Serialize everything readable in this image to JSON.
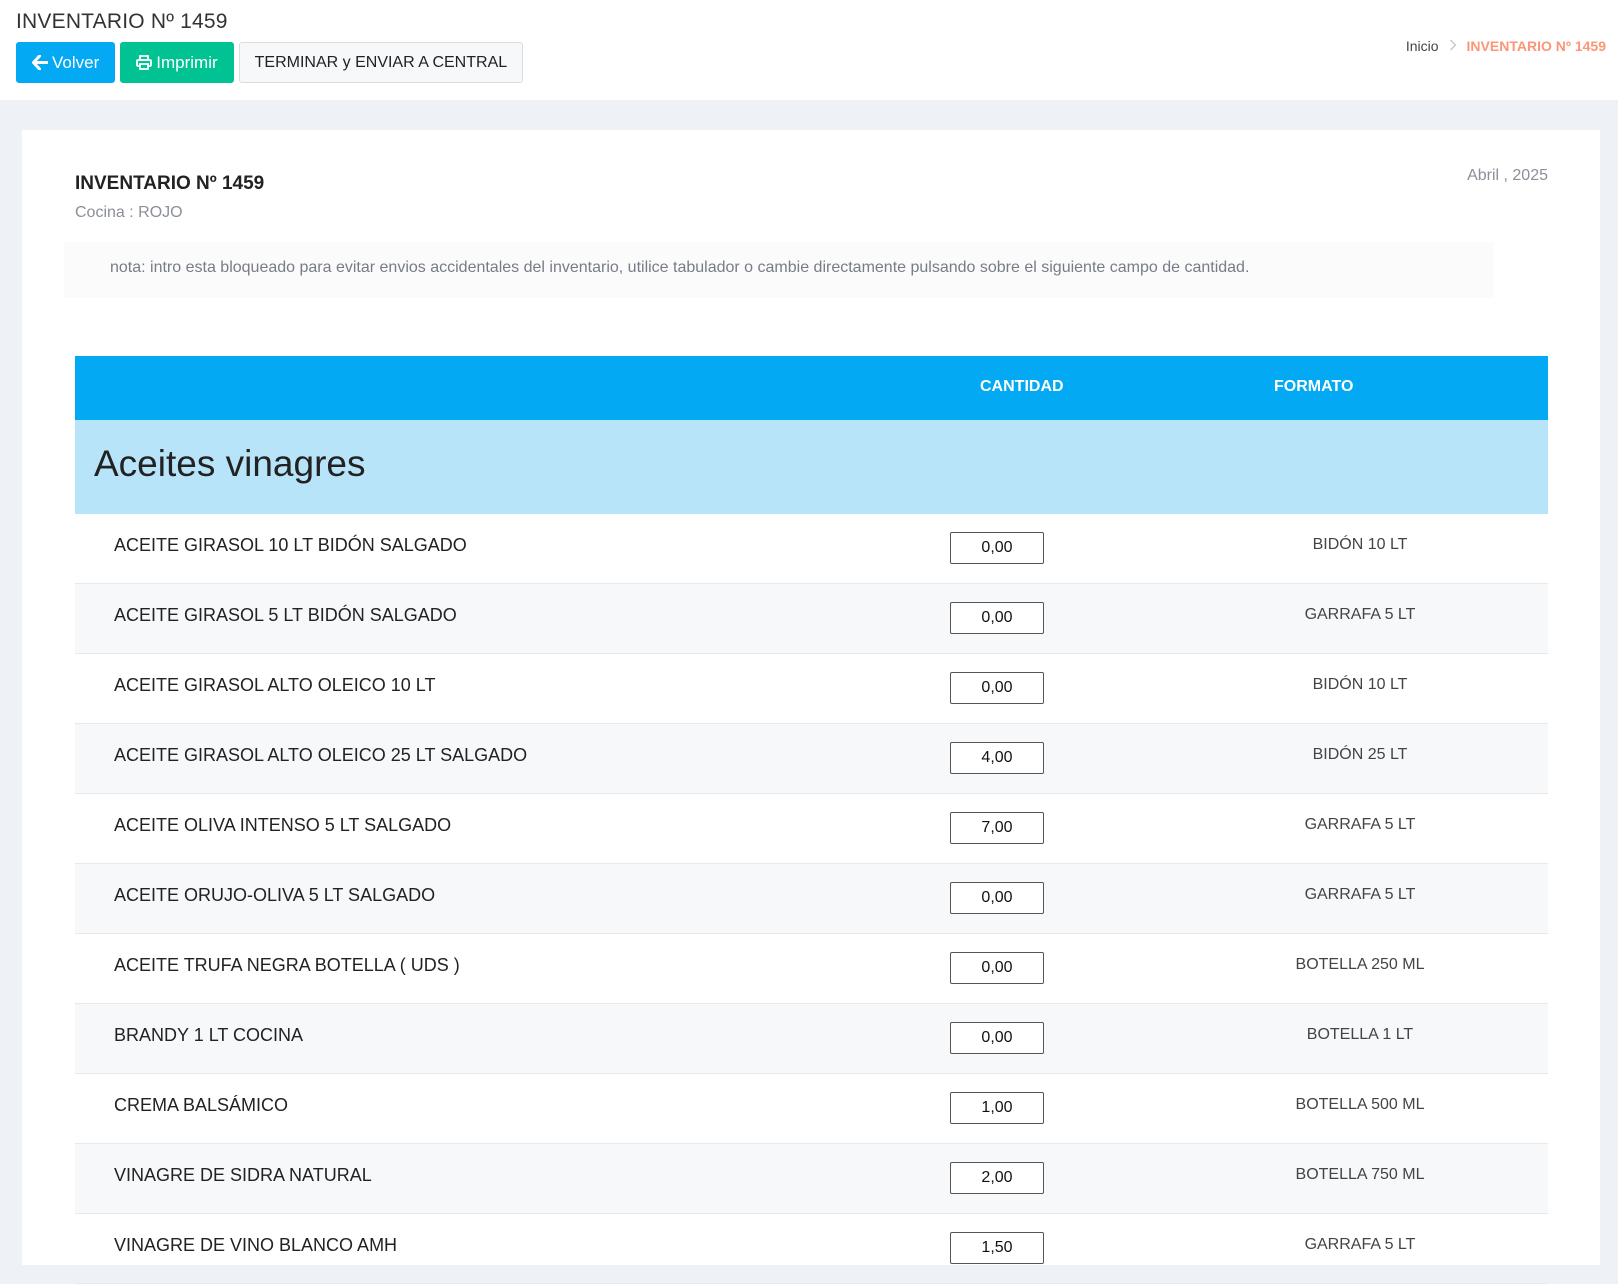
{
  "header": {
    "title": "INVENTARIO Nº 1459",
    "buttons": {
      "back": "Volver",
      "print": "Imprimir",
      "finish": "TERMINAR y ENVIAR A CENTRAL"
    },
    "breadcrumb": {
      "home": "Inicio",
      "current": "INVENTARIO Nº 1459"
    }
  },
  "card": {
    "title": "INVENTARIO Nº 1459",
    "subtitle": "Cocina : ROJO",
    "date": "Abril , 2025",
    "note": "nota: intro esta bloqueado para evitar envios accidentales del inventario, utilice tabulador o cambie directamente pulsando sobre el siguiente campo de cantidad."
  },
  "table": {
    "columns": {
      "quantity": "CANTIDAD",
      "format": "FORMATO"
    },
    "group": "Aceites vinagres",
    "rows": [
      {
        "name": "ACEITE GIRASOL 10 LT BIDÓN SALGADO",
        "quantity": "0,00",
        "format": "BIDÓN 10 LT"
      },
      {
        "name": "ACEITE GIRASOL 5 LT BIDÓN SALGADO",
        "quantity": "0,00",
        "format": "GARRAFA 5 LT"
      },
      {
        "name": "ACEITE GIRASOL ALTO OLEICO 10 LT",
        "quantity": "0,00",
        "format": "BIDÓN 10 LT"
      },
      {
        "name": "ACEITE GIRASOL ALTO OLEICO 25 LT SALGADO",
        "quantity": "4,00",
        "format": "BIDÓN 25 LT"
      },
      {
        "name": "ACEITE OLIVA INTENSO 5 LT SALGADO",
        "quantity": "7,00",
        "format": "GARRAFA 5 LT"
      },
      {
        "name": "ACEITE ORUJO-OLIVA 5 LT SALGADO",
        "quantity": "0,00",
        "format": "GARRAFA 5 LT"
      },
      {
        "name": "ACEITE TRUFA NEGRA BOTELLA ( UDS )",
        "quantity": "0,00",
        "format": "BOTELLA 250 ML"
      },
      {
        "name": "BRANDY 1 LT COCINA",
        "quantity": "0,00",
        "format": "BOTELLA 1 LT"
      },
      {
        "name": "CREMA BALSÁMICO",
        "quantity": "1,00",
        "format": "BOTELLA 500 ML"
      },
      {
        "name": "VINAGRE DE SIDRA NATURAL",
        "quantity": "2,00",
        "format": "BOTELLA 750 ML"
      },
      {
        "name": "VINAGRE DE VINO BLANCO AMH",
        "quantity": "1,50",
        "format": "GARRAFA 5 LT"
      }
    ]
  },
  "colors": {
    "primary": "#03a9f3",
    "success": "#00c292",
    "group_bg": "#b7e4f9",
    "breadcrumb_active": "#fb9678"
  },
  "icons": {
    "back": "arrow-left-icon",
    "print": "print-icon",
    "breadcrumb_separator": "chevron-right-icon"
  }
}
